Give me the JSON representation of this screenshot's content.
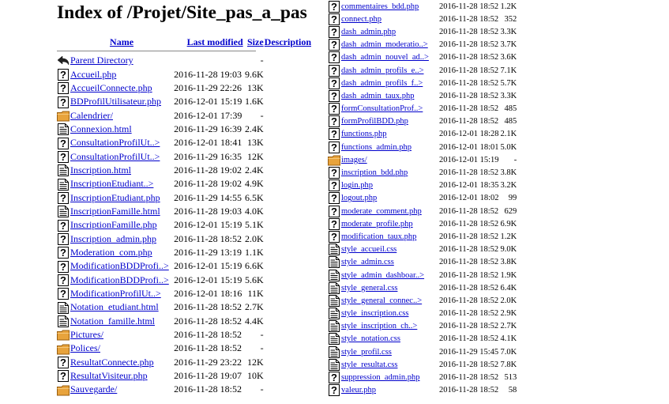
{
  "page": {
    "title": "Index of /Projet/Site_pas_a_pas"
  },
  "header": {
    "name": "Name",
    "modified": "Last modified",
    "size": "Size",
    "description": "Description"
  },
  "left_rows": [
    {
      "icon": "back-icon",
      "name": "Parent Directory",
      "date": "",
      "size": "-"
    },
    {
      "icon": "file-unknown-icon",
      "name": "Accueil.php",
      "date": "2016-11-28 19:03",
      "size": "9.6K"
    },
    {
      "icon": "file-unknown-icon",
      "name": "AccueilConnecte.php",
      "date": "2016-11-29 22:26",
      "size": "13K"
    },
    {
      "icon": "file-unknown-icon",
      "name": "BDProfilUtilisateur.php",
      "date": "2016-12-01 15:19",
      "size": "1.6K"
    },
    {
      "icon": "folder-icon",
      "name": "Calendrier/",
      "date": "2016-12-01 17:39",
      "size": "-"
    },
    {
      "icon": "file-text-icon",
      "name": "Connexion.html",
      "date": "2016-11-29 16:39",
      "size": "2.4K"
    },
    {
      "icon": "file-unknown-icon",
      "name": "ConsultationProfilUt..>",
      "date": "2016-12-01 18:41",
      "size": "13K"
    },
    {
      "icon": "file-unknown-icon",
      "name": "ConsultationProfilUt..>",
      "date": "2016-11-29 16:35",
      "size": "12K"
    },
    {
      "icon": "file-text-icon",
      "name": "Inscription.html",
      "date": "2016-11-28 19:02",
      "size": "2.4K"
    },
    {
      "icon": "file-text-icon",
      "name": "InscriptionEtudiant..>",
      "date": "2016-11-28 19:02",
      "size": "4.9K"
    },
    {
      "icon": "file-unknown-icon",
      "name": "InscriptionEtudiant.php",
      "date": "2016-11-29 14:55",
      "size": "6.5K"
    },
    {
      "icon": "file-text-icon",
      "name": "InscriptionFamille.html",
      "date": "2016-11-28 19:03",
      "size": "4.0K"
    },
    {
      "icon": "file-unknown-icon",
      "name": "InscriptionFamille.php",
      "date": "2016-12-01 15:19",
      "size": "5.1K"
    },
    {
      "icon": "file-unknown-icon",
      "name": "Inscription_admin.php",
      "date": "2016-11-28 18:52",
      "size": "2.0K"
    },
    {
      "icon": "file-unknown-icon",
      "name": "Moderation_com.php",
      "date": "2016-11-29 13:19",
      "size": "1.1K"
    },
    {
      "icon": "file-unknown-icon",
      "name": "ModificationBDDProfi..>",
      "date": "2016-12-01 15:19",
      "size": "6.6K"
    },
    {
      "icon": "file-unknown-icon",
      "name": "ModificationBDDProfi..>",
      "date": "2016-12-01 15:19",
      "size": "5.6K"
    },
    {
      "icon": "file-unknown-icon",
      "name": "ModificationProfilUt..>",
      "date": "2016-12-01 18:16",
      "size": "11K"
    },
    {
      "icon": "file-text-icon",
      "name": "Notation_etudiant.html",
      "date": "2016-11-28 18:52",
      "size": "2.7K"
    },
    {
      "icon": "file-text-icon",
      "name": "Notation_famille.html",
      "date": "2016-11-28 18:52",
      "size": "4.4K"
    },
    {
      "icon": "folder-icon",
      "name": "Pictures/",
      "date": "2016-11-28 18:52",
      "size": "-"
    },
    {
      "icon": "folder-icon",
      "name": "Polices/",
      "date": "2016-11-28 18:52",
      "size": "-"
    },
    {
      "icon": "file-unknown-icon",
      "name": "ResultatConnecte.php",
      "date": "2016-11-29 23:22",
      "size": "12K"
    },
    {
      "icon": "file-unknown-icon",
      "name": "ResultatVisiteur.php",
      "date": "2016-11-28 19:07",
      "size": "10K"
    },
    {
      "icon": "folder-icon",
      "name": "Sauvegarde/",
      "date": "2016-11-28 18:52",
      "size": "-"
    }
  ],
  "right_rows": [
    {
      "icon": "file-unknown-icon",
      "name": "commentaires_bdd.php",
      "date": "2016-11-28 18:52",
      "size": "1.2K"
    },
    {
      "icon": "file-unknown-icon",
      "name": "connect.php",
      "date": "2016-11-28 18:52",
      "size": "352"
    },
    {
      "icon": "file-unknown-icon",
      "name": "dash_admin.php",
      "date": "2016-11-28 18:52",
      "size": "3.3K"
    },
    {
      "icon": "file-unknown-icon",
      "name": "dash_admin_moderatio..>",
      "date": "2016-11-28 18:52",
      "size": "3.7K"
    },
    {
      "icon": "file-unknown-icon",
      "name": "dash_admin_nouvel_ad..>",
      "date": "2016-11-28 18:52",
      "size": "3.6K"
    },
    {
      "icon": "file-unknown-icon",
      "name": "dash_admin_profils_e..>",
      "date": "2016-11-28 18:52",
      "size": "7.1K"
    },
    {
      "icon": "file-unknown-icon",
      "name": "dash_admin_profils_f..>",
      "date": "2016-11-28 18:52",
      "size": "5.7K"
    },
    {
      "icon": "file-unknown-icon",
      "name": "dash_admin_taux.php",
      "date": "2016-11-28 18:52",
      "size": "3.3K"
    },
    {
      "icon": "file-unknown-icon",
      "name": "formConsultationProf..>",
      "date": "2016-11-28 18:52",
      "size": "485"
    },
    {
      "icon": "file-unknown-icon",
      "name": "formProfilBDD.php",
      "date": "2016-11-28 18:52",
      "size": "485"
    },
    {
      "icon": "file-unknown-icon",
      "name": "functions.php",
      "date": "2016-12-01 18:28",
      "size": "2.1K"
    },
    {
      "icon": "file-unknown-icon",
      "name": "functions_admin.php",
      "date": "2016-12-01 18:01",
      "size": "5.0K"
    },
    {
      "icon": "folder-icon",
      "name": "images/",
      "date": "2016-12-01 15:19",
      "size": "-"
    },
    {
      "icon": "file-unknown-icon",
      "name": "inscription_bdd.php",
      "date": "2016-11-28 18:52",
      "size": "3.8K"
    },
    {
      "icon": "file-unknown-icon",
      "name": "login.php",
      "date": "2016-12-01 18:35",
      "size": "3.2K"
    },
    {
      "icon": "file-unknown-icon",
      "name": "logout.php",
      "date": "2016-12-01 18:02",
      "size": "99"
    },
    {
      "icon": "file-unknown-icon",
      "name": "moderate_comment.php",
      "date": "2016-11-28 18:52",
      "size": "629"
    },
    {
      "icon": "file-unknown-icon",
      "name": "moderate_profile.php",
      "date": "2016-11-28 18:52",
      "size": "6.9K"
    },
    {
      "icon": "file-unknown-icon",
      "name": "modification_taux.php",
      "date": "2016-11-28 18:52",
      "size": "1.2K"
    },
    {
      "icon": "file-text-icon",
      "name": "style_accueil.css",
      "date": "2016-11-28 18:52",
      "size": "9.0K"
    },
    {
      "icon": "file-text-icon",
      "name": "style_admin.css",
      "date": "2016-11-28 18:52",
      "size": "3.8K"
    },
    {
      "icon": "file-text-icon",
      "name": "style_admin_dashboar..>",
      "date": "2016-11-28 18:52",
      "size": "1.9K"
    },
    {
      "icon": "file-text-icon",
      "name": "style_general.css",
      "date": "2016-11-28 18:52",
      "size": "6.4K"
    },
    {
      "icon": "file-text-icon",
      "name": "style_general_connec..>",
      "date": "2016-11-28 18:52",
      "size": "2.0K"
    },
    {
      "icon": "file-text-icon",
      "name": "style_inscription.css",
      "date": "2016-11-28 18:52",
      "size": "2.9K"
    },
    {
      "icon": "file-text-icon",
      "name": "style_inscription_ch..>",
      "date": "2016-11-28 18:52",
      "size": "2.7K"
    },
    {
      "icon": "file-text-icon",
      "name": "style_notation.css",
      "date": "2016-11-28 18:52",
      "size": "4.1K"
    },
    {
      "icon": "file-text-icon",
      "name": "style_profil.css",
      "date": "2016-11-29 15:45",
      "size": "7.0K"
    },
    {
      "icon": "file-text-icon",
      "name": "style_resultat.css",
      "date": "2016-11-28 18:52",
      "size": "7.8K"
    },
    {
      "icon": "file-unknown-icon",
      "name": "suppression_admin.php",
      "date": "2016-11-28 18:52",
      "size": "513"
    },
    {
      "icon": "file-unknown-icon",
      "name": "valeur.php",
      "date": "2016-11-28 18:52",
      "size": "58"
    }
  ],
  "colors": {
    "link": "#0000cc",
    "folder": "#e8a33c",
    "rule": "#888888"
  }
}
